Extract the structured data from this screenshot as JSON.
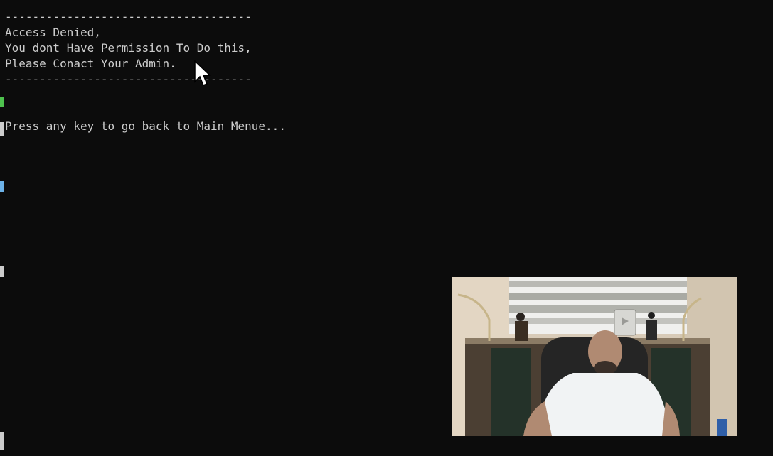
{
  "console": {
    "lines": [
      "------------------------------------",
      "Access Denied,",
      "You dont Have Permission To Do this,",
      "Please Conact Your Admin.",
      "------------------------------------",
      "",
      "",
      "Press any key to go back to Main Menue..."
    ]
  },
  "colors": {
    "background": "#0c0c0c",
    "text": "#cccccc"
  },
  "cursor": {
    "icon": "mouse-pointer-icon"
  },
  "webcam": {
    "icon": "presenter-webcam-overlay"
  }
}
